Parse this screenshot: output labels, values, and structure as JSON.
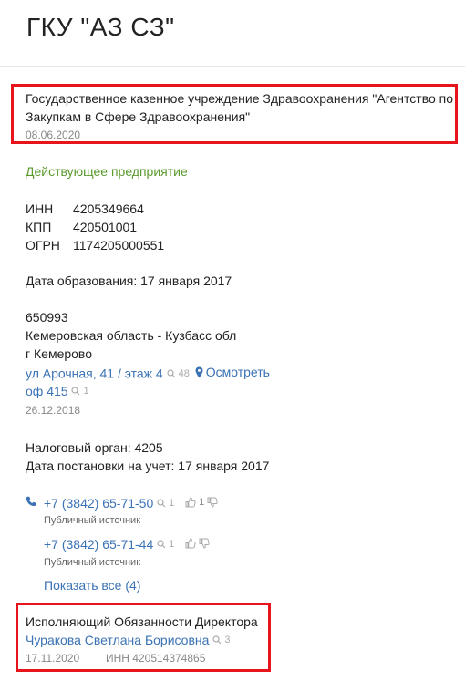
{
  "header": {
    "title": "ГКУ \"АЗ СЗ\""
  },
  "fullname": {
    "line1": "Государственное казенное учреждение Здравоохранения \"Агентство по",
    "line2": "Закупкам в Сфере Здравоохранения\"",
    "date": "08.06.2020"
  },
  "status": "Действующее предприятие",
  "requisites": [
    {
      "label": "ИНН",
      "value": "4205349664"
    },
    {
      "label": "КПП",
      "value": "420501001"
    },
    {
      "label": "ОГРН",
      "value": "1174205000551"
    }
  ],
  "founded": "Дата образования: 17 января 2017",
  "address": {
    "zip": "650993",
    "region": "Кемеровская область - Кузбасс обл",
    "city": "г Кемерово",
    "street_link": "ул Арочная, 41 / этаж 4",
    "street_count": "48",
    "map_link": "Осмотреть",
    "office_link": "оф 415",
    "office_count": "1",
    "date": "26.12.2018"
  },
  "tax": {
    "authority": "Налоговый орган: 4205",
    "registered": "Дата постановки на учет: 17 января 2017"
  },
  "phones": [
    {
      "number": "+7 (3842) 65-71-50",
      "count": "1",
      "likes": "1",
      "source": "Публичный источник"
    },
    {
      "number": "+7 (3842) 65-71-44",
      "count": "1",
      "likes": "",
      "source": "Публичный источник"
    }
  ],
  "show_all": "Показать все (4)",
  "director": {
    "position": "Исполняющий Обязанности Директора",
    "name": "Чуракова Светлана Борисовна",
    "count": "3",
    "date": "17.11.2020",
    "inn": "ИНН 420514374865"
  },
  "colors": {
    "link": "#3a72b5",
    "status_green": "#5a9a2c",
    "highlight_red": "#e8141c"
  }
}
